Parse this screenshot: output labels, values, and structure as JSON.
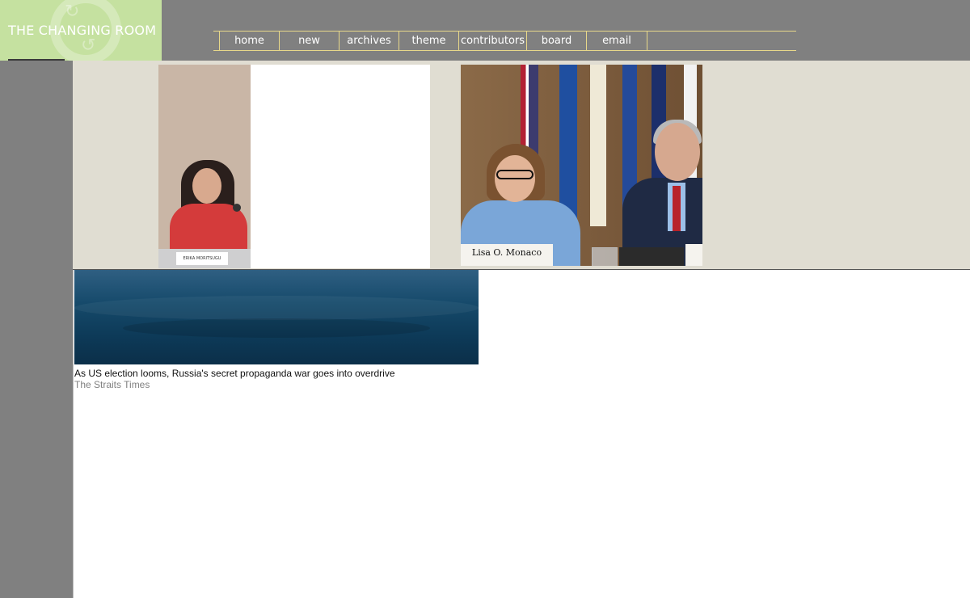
{
  "site": {
    "logo_text": "THE CHANGING ROOM"
  },
  "nav": {
    "items": [
      {
        "label": "home"
      },
      {
        "label": "new"
      },
      {
        "label": "archives"
      },
      {
        "label": "theme"
      },
      {
        "label": "contributors"
      },
      {
        "label": "board"
      },
      {
        "label": "email"
      }
    ]
  },
  "photos": {
    "photo1": {
      "placard_text": "ERIKA MORITSUGU"
    },
    "photo2": {
      "placard_text": "Lisa O. Monaco"
    }
  },
  "article": {
    "title": "As US election looms, Russia's secret propaganda war goes into overdrive",
    "source": "The Straits Times"
  },
  "colors": {
    "background": "#808080",
    "logo_bg": "#c5e1a0",
    "nav_border": "#e8d88a",
    "strip_bg": "#e0ddd2",
    "main_bg": "#ffffff"
  }
}
